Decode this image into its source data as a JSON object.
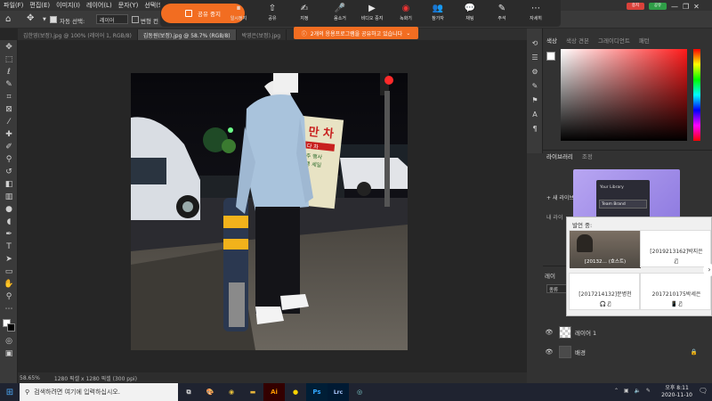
{
  "menubar": [
    "파일(F)",
    "편집(E)",
    "이미지(I)",
    "레이어(L)",
    "문자(Y)",
    "선택(S)"
  ],
  "options": {
    "auto_select": "자동 선택:",
    "auto_select_value": "레이어",
    "transform": "변형 컨"
  },
  "zoom": {
    "stop_share": "공유 중지",
    "buttons": [
      "일시정지",
      "공유",
      "지정",
      "음소거",
      "비디오 중지",
      "녹화기",
      "참가자",
      "채팅",
      "주석",
      "자세히"
    ],
    "banner": "2개의 응용프로그램을 공유하고 있습니다",
    "speaker_title": "발언 중:",
    "participants": [
      "[20132… (호스트)",
      "[2019213162]박지은",
      "[2017214132]문병천",
      "2017210175박세은"
    ]
  },
  "window_controls": {
    "stop": "중지",
    "share": "공유"
  },
  "doc_tabs": [
    "김한영(보정).jpg @ 100% (레이어 1, RGB/8)",
    "김동원(보정).jpg @ 58.7% (RGB/8)",
    "박영은(보정).jpg"
  ],
  "photo_sign": {
    "line1": "만 차",
    "line2": "다 차",
    "line3": "주 행사",
    "line4": "행 세일"
  },
  "status": {
    "zoom": "58.65%",
    "doc": "1280 픽셀 x 1280 픽셀 (300 ppi)"
  },
  "panels": {
    "color_tabs": [
      "색상",
      "색상 견본",
      "그레이디언트",
      "패턴"
    ],
    "library_tabs": [
      "라이브러리",
      "조정"
    ],
    "library_new": "+ 새 라이브러",
    "library_items": [
      "Your Library",
      "Team Brand"
    ],
    "library_label": "내 라이",
    "layer_tab": "레이",
    "layer_search": "종류",
    "layers": [
      {
        "name": "레이어 1"
      },
      {
        "name": "배경"
      }
    ]
  },
  "taskbar": {
    "search_placeholder": "검색하려면 여기에 입력하십시오.",
    "apps": [
      "Ai",
      "Ps",
      "Lrc"
    ],
    "time": "오후 8:11",
    "date": "2020-11-10"
  },
  "colors": {
    "accent": "#f26d21",
    "stop_red": "#d9413a",
    "share_green": "#2f9e47"
  }
}
